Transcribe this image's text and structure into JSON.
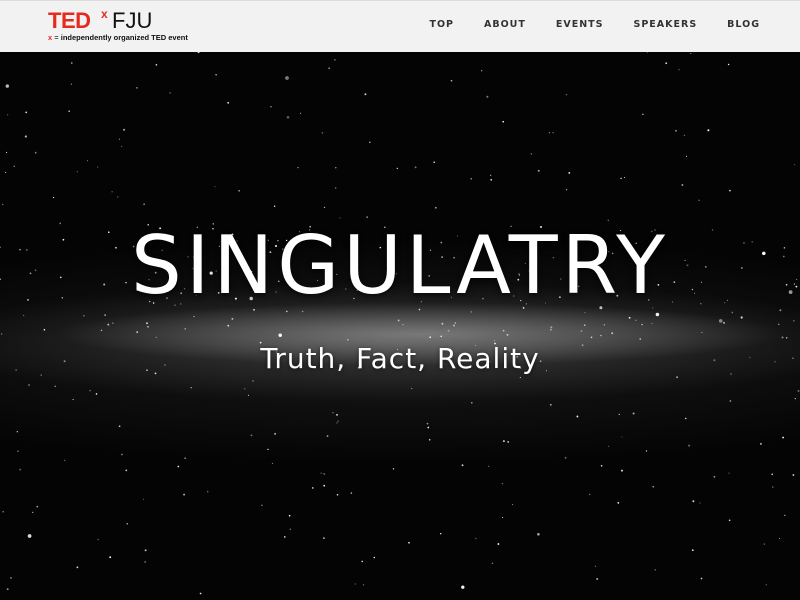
{
  "header": {
    "logo": {
      "ted": "TED",
      "x": "x",
      "name": "FJU",
      "tagline_x": "x",
      "tagline_eq": " = ",
      "tagline_rest": "independently organized TED event"
    },
    "nav": [
      {
        "label": "TOP"
      },
      {
        "label": "ABOUT"
      },
      {
        "label": "EVENTS"
      },
      {
        "label": "SPEAKERS"
      },
      {
        "label": "BLOG"
      }
    ]
  },
  "hero": {
    "title": "SINGULATRY",
    "subtitle": "Truth, Fact, Reality"
  },
  "colors": {
    "brand_red": "#e62b1e",
    "nav_bg": "#f2f2f2",
    "nav_text": "#333333",
    "hero_text": "#ffffff"
  }
}
